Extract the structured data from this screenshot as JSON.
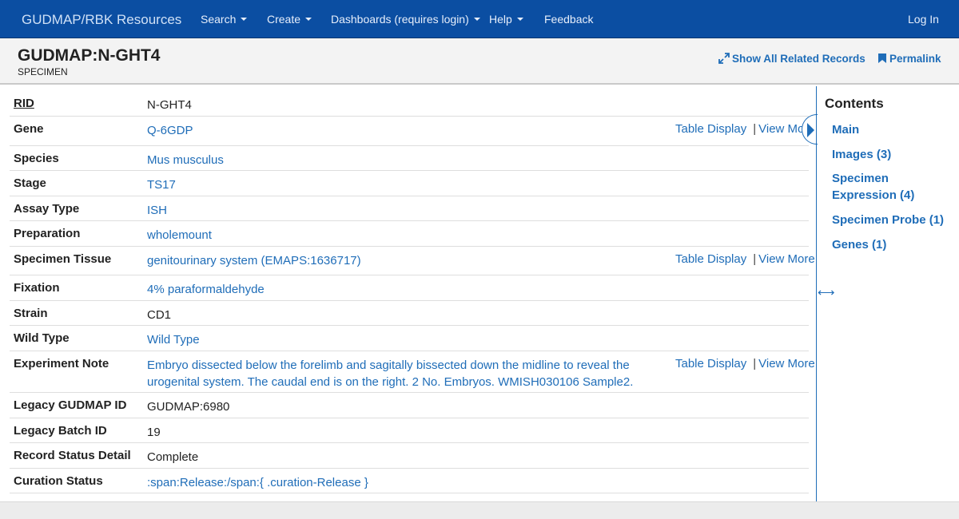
{
  "nav": {
    "brand": "GUDMAP/RBK Resources",
    "items": [
      {
        "label": "Search",
        "dropdown": true
      },
      {
        "label": "Create",
        "dropdown": true
      },
      {
        "label": "Dashboards (requires login)",
        "dropdown": true
      },
      {
        "label": "Help",
        "dropdown": true
      },
      {
        "label": "Feedback",
        "dropdown": false
      }
    ],
    "login": "Log In"
  },
  "header": {
    "title": "GUDMAP:N-GHT4",
    "subtitle": "SPECIMEN",
    "show_all_label": "Show All Related Records",
    "permalink_label": "Permalink"
  },
  "record": {
    "rows": [
      {
        "key": "RID",
        "value": "N-GHT4"
      },
      {
        "key": "Gene",
        "value": "Q-6GDP",
        "table_display": "Table Display",
        "view_more": "View More"
      },
      {
        "key": "Species",
        "value": "Mus musculus"
      },
      {
        "key": "Stage",
        "value": "TS17"
      },
      {
        "key": "Assay Type",
        "value": "ISH"
      },
      {
        "key": "Preparation",
        "value": "wholemount"
      },
      {
        "key": "Specimen Tissue",
        "value": "genitourinary system (EMAPS:1636717)",
        "table_display": "Table Display",
        "view_more": "View More"
      },
      {
        "key": "Fixation",
        "value": "4% paraformaldehyde"
      },
      {
        "key": "Strain",
        "value": "CD1"
      },
      {
        "key": "Wild Type",
        "value": "Wild Type"
      },
      {
        "key": "Experiment Note",
        "value": "Embryo dissected below the forelimb and sagitally bissected down the midline to reveal the urogenital system. The caudal end is on the right. 2 No. Embryos. WMISH030106 Sample2.",
        "table_display": "Table Display",
        "view_more": "View More"
      },
      {
        "key": "Legacy GUDMAP ID",
        "value": "GUDMAP:6980"
      },
      {
        "key": "Legacy Batch ID",
        "value": "19"
      },
      {
        "key": "Record Status Detail",
        "value": "Complete"
      },
      {
        "key": "Curation Status",
        "value": ":span:Release:/span:{ .curation-Release }"
      }
    ]
  },
  "sidebar": {
    "title": "Contents",
    "items": [
      {
        "label": "Main"
      },
      {
        "label": "Images (3)"
      },
      {
        "label": "Specimen Expression (4)"
      },
      {
        "label": "Specimen Probe (1)"
      },
      {
        "label": "Genes (1)"
      }
    ]
  },
  "colors": {
    "navbar": "#0b4ea2",
    "link": "#1f6db8",
    "header_bg": "#f3f3f3"
  }
}
